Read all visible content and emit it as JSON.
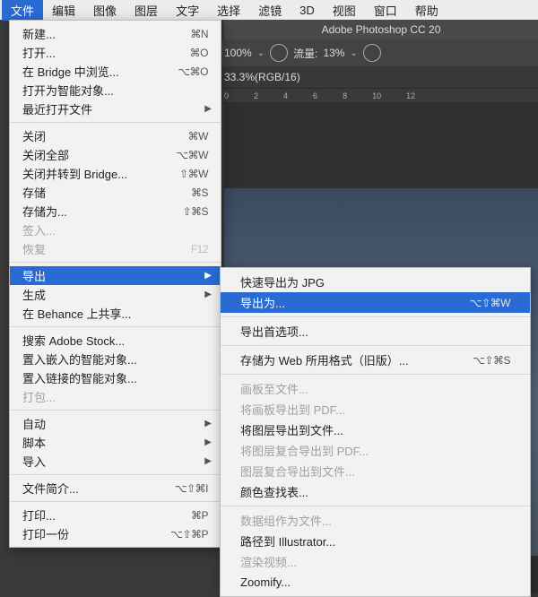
{
  "menubar": [
    "文件",
    "编辑",
    "图像",
    "图层",
    "文字",
    "选择",
    "滤镜",
    "3D",
    "视图",
    "窗口",
    "帮助"
  ],
  "menubar_active_index": 0,
  "app_title": "Adobe Photoshop CC 20",
  "options": {
    "opacity_label": "100%",
    "flow_label": "流量:",
    "flow_value": "13%"
  },
  "doc_tab": "33.3%(RGB/16)",
  "ruler_ticks": [
    "0",
    "2",
    "4",
    "6",
    "8",
    "10",
    "12"
  ],
  "file_menu": [
    {
      "label": "新建...",
      "sc": "⌘N"
    },
    {
      "label": "打开...",
      "sc": "⌘O"
    },
    {
      "label": "在 Bridge 中浏览...",
      "sc": "⌥⌘O"
    },
    {
      "label": "打开为智能对象..."
    },
    {
      "label": "最近打开文件",
      "arrow": true
    },
    {
      "sep": true
    },
    {
      "label": "关闭",
      "sc": "⌘W"
    },
    {
      "label": "关闭全部",
      "sc": "⌥⌘W"
    },
    {
      "label": "关闭并转到 Bridge...",
      "sc": "⇧⌘W"
    },
    {
      "label": "存储",
      "sc": "⌘S"
    },
    {
      "label": "存储为...",
      "sc": "⇧⌘S"
    },
    {
      "label": "签入...",
      "disabled": true
    },
    {
      "label": "恢复",
      "sc": "F12",
      "disabled": true
    },
    {
      "sep": true
    },
    {
      "label": "导出",
      "arrow": true,
      "hl": true
    },
    {
      "label": "生成",
      "arrow": true
    },
    {
      "label": "在 Behance 上共享..."
    },
    {
      "sep": true
    },
    {
      "label": "搜索 Adobe Stock..."
    },
    {
      "label": "置入嵌入的智能对象..."
    },
    {
      "label": "置入链接的智能对象..."
    },
    {
      "label": "打包...",
      "disabled": true
    },
    {
      "sep": true
    },
    {
      "label": "自动",
      "arrow": true
    },
    {
      "label": "脚本",
      "arrow": true
    },
    {
      "label": "导入",
      "arrow": true
    },
    {
      "sep": true
    },
    {
      "label": "文件简介...",
      "sc": "⌥⇧⌘I"
    },
    {
      "sep": true
    },
    {
      "label": "打印...",
      "sc": "⌘P"
    },
    {
      "label": "打印一份",
      "sc": "⌥⇧⌘P"
    }
  ],
  "export_menu": [
    {
      "label": "快速导出为 JPG"
    },
    {
      "label": "导出为...",
      "sc": "⌥⇧⌘W",
      "hl": true
    },
    {
      "sep": true
    },
    {
      "label": "导出首选项..."
    },
    {
      "sep": true
    },
    {
      "label": "存储为 Web 所用格式（旧版）...",
      "sc": "⌥⇧⌘S"
    },
    {
      "sep": true
    },
    {
      "label": "画板至文件...",
      "disabled": true
    },
    {
      "label": "将画板导出到 PDF...",
      "disabled": true
    },
    {
      "label": "将图层导出到文件..."
    },
    {
      "label": "将图层复合导出到 PDF...",
      "disabled": true
    },
    {
      "label": "图层复合导出到文件...",
      "disabled": true
    },
    {
      "label": "颜色查找表..."
    },
    {
      "sep": true
    },
    {
      "label": "数据组作为文件...",
      "disabled": true
    },
    {
      "label": "路径到 Illustrator..."
    },
    {
      "label": "渲染视频...",
      "disabled": true
    },
    {
      "label": "Zoomify..."
    }
  ]
}
